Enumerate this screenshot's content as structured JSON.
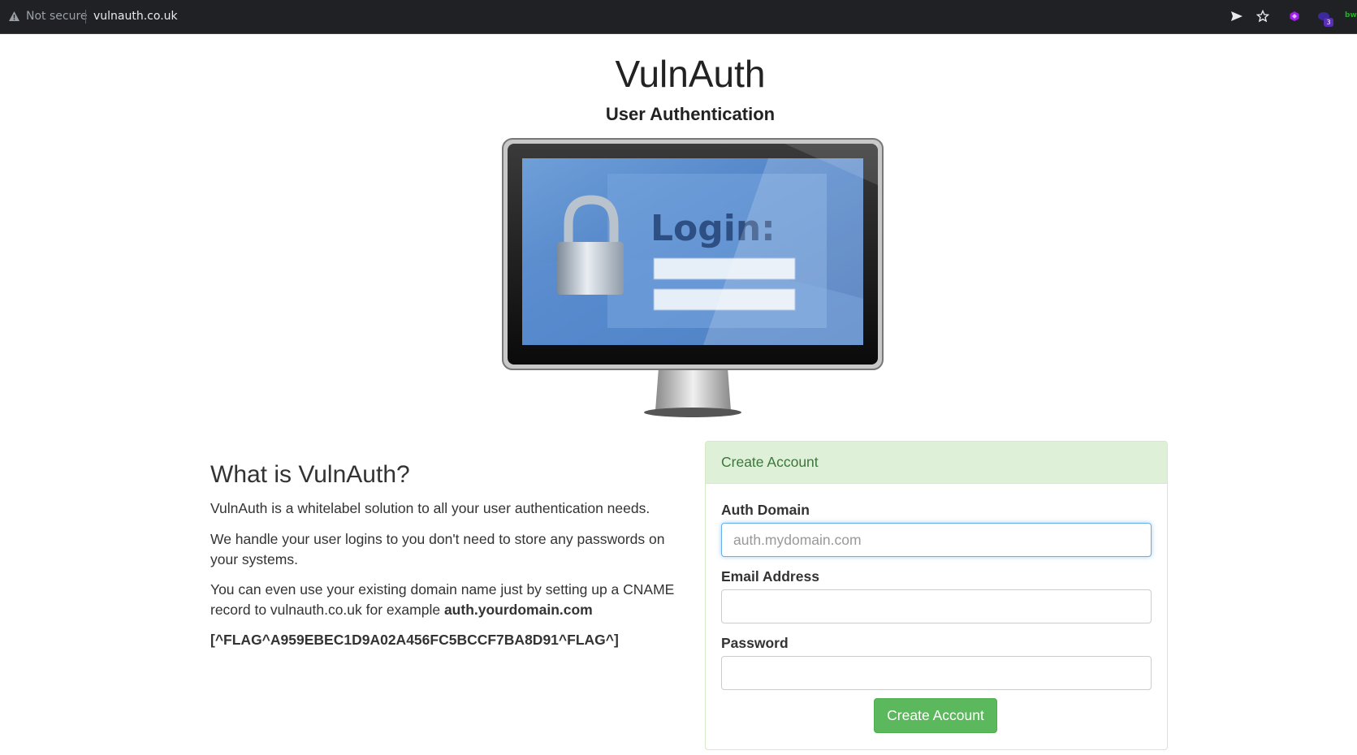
{
  "browser": {
    "security_label": "Not secure",
    "url": "vulnauth.co.uk",
    "extension_badge": "3",
    "extension_text": "bw"
  },
  "header": {
    "title": "VulnAuth",
    "subtitle": "User Authentication"
  },
  "hero": {
    "screen_text": "Login:"
  },
  "about": {
    "heading": "What is VulnAuth?",
    "paragraph1": "VulnAuth is a whitelabel solution to all your user authentication needs.",
    "paragraph2": "We handle your user logins to you don't need to store any passwords on your systems.",
    "paragraph3_text": "You can even use your existing domain name just by setting up a CNAME record to vulnauth.co.uk for example ",
    "paragraph3_bold": "auth.yourdomain.com",
    "flag": "[^FLAG^A959EBEC1D9A02A456FC5BCCF7BA8D91^FLAG^]"
  },
  "form": {
    "heading": "Create Account",
    "domain_label": "Auth Domain",
    "domain_placeholder": "auth.mydomain.com",
    "domain_value": "",
    "email_label": "Email Address",
    "email_value": "",
    "password_label": "Password",
    "password_value": "",
    "submit_label": "Create Account"
  },
  "colors": {
    "browser_bar": "#202124",
    "panel_heading_bg": "#dff0d8",
    "panel_heading_text": "#3c763d",
    "success_button": "#5cb85c",
    "focus_border": "#66afe9"
  }
}
